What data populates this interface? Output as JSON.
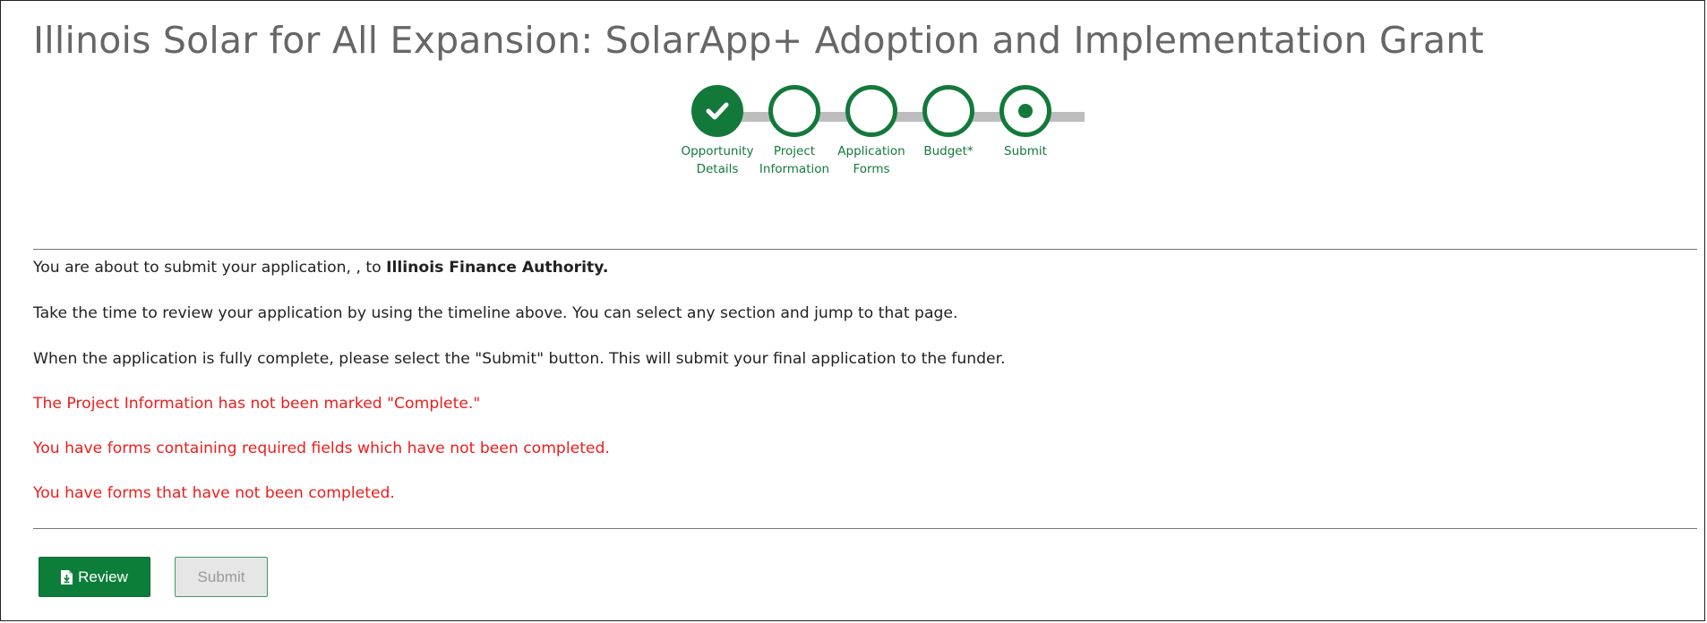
{
  "page": {
    "title": "Illinois Solar for All Expansion: SolarApp+ Adoption and Implementation Grant"
  },
  "timeline": {
    "steps": [
      {
        "label": "Opportunity\nDetails",
        "state": "complete"
      },
      {
        "label": "Project\nInformation",
        "state": "incomplete"
      },
      {
        "label": "Application\nForms",
        "state": "incomplete"
      },
      {
        "label": "Budget*",
        "state": "incomplete"
      },
      {
        "label": "Submit",
        "state": "current"
      }
    ]
  },
  "messages": {
    "intro_prefix": "You are about to submit your application, , to ",
    "funder": "Illinois Finance Authority.",
    "review_hint": "Take the time to review your application by using the timeline above. You can select any section and jump to that page.",
    "submit_hint": "When the application is fully complete, please select the \"Submit\" button. This will submit your final application to the funder.",
    "errors": [
      "The Project Information has not been marked \"Complete.\"",
      "You have forms containing required fields which have not been completed.",
      "You have forms that have not been completed."
    ]
  },
  "buttons": {
    "review_label": "Review",
    "submit_label": "Submit",
    "review_icon": "document-download-icon"
  },
  "colors": {
    "accent_green": "#13793b",
    "error_red": "#ee1d1d",
    "title_gray": "#666666"
  }
}
